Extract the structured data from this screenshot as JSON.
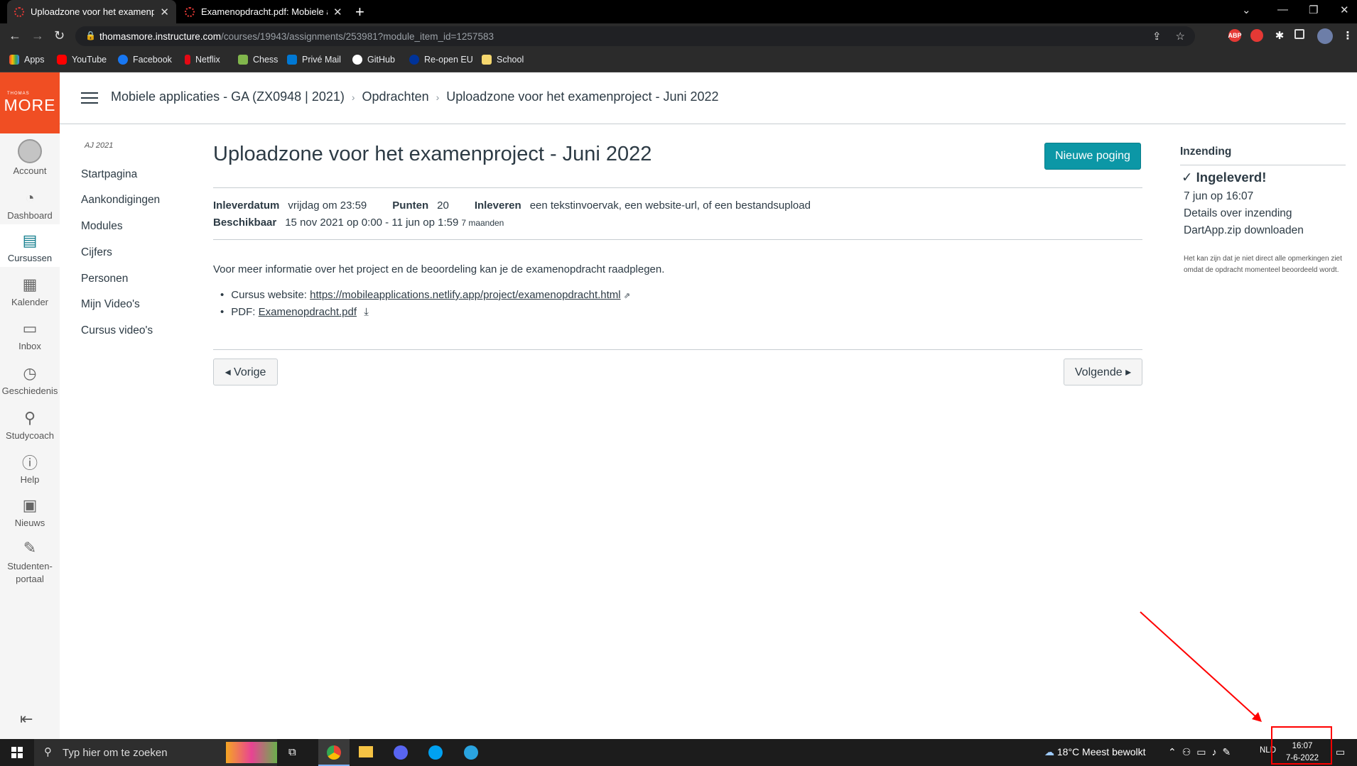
{
  "browser": {
    "tabs": [
      {
        "title": "Uploadzone voor het examenpro",
        "active": true
      },
      {
        "title": "Examenopdracht.pdf: Mobiele ap",
        "active": false
      }
    ],
    "url_host": "thomasmore.instructure.com",
    "url_path": "/courses/19943/assignments/253981?module_item_id=1257583",
    "bookmarks": [
      "Apps",
      "YouTube",
      "Facebook",
      "Netflix",
      "Chess",
      "Privé Mail",
      "GitHub",
      "Re-open EU",
      "School"
    ],
    "ext_abp": "ABP"
  },
  "logo": {
    "small": "THOMAS",
    "big": "MORE"
  },
  "global_nav": [
    "Account",
    "Dashboard",
    "Cursussen",
    "Kalender",
    "Inbox",
    "Geschiedenis",
    "Studycoach",
    "Help",
    "Nieuws",
    "Studenten-portaal"
  ],
  "breadcrumb": [
    "Mobiele applicaties - GA (ZX0948 | 2021)",
    "Opdrachten",
    "Uploadzone voor het examenproject - Juni 2022"
  ],
  "course_nav": {
    "term": "AJ 2021",
    "items": [
      "Startpagina",
      "Aankondigingen",
      "Modules",
      "Cijfers",
      "Personen",
      "Mijn Video's",
      "Cursus video's"
    ]
  },
  "assignment": {
    "title": "Uploadzone voor het examenproject - Juni 2022",
    "new_attempt": "Nieuwe poging",
    "due_label": "Inleverdatum",
    "due_value": "vrijdag om 23:59",
    "points_label": "Punten",
    "points_value": "20",
    "submit_label": "Inleveren",
    "submit_value": "een tekstinvoervak, een website-url, of een bestandsupload",
    "avail_label": "Beschikbaar",
    "avail_value": "15 nov 2021 op 0:00 - 11 jun op 1:59",
    "avail_extra": "7 maanden",
    "description": "Voor meer informatie over het project en de beoordeling kan je de examenopdracht raadplegen.",
    "website_prefix": "Cursus website:",
    "website_link": "https://mobileapplications.netlify.app/project/examenopdracht.html",
    "pdf_prefix": "PDF:",
    "pdf_link": "Examenopdracht.pdf",
    "prev": "◂ Vorige",
    "next": "Volgende ▸"
  },
  "submission": {
    "heading": "Inzending",
    "status": "Ingeleverd!",
    "date": "7 jun op 16:07",
    "details": "Details over inzending",
    "download": "DartApp.zip downloaden",
    "note": "Het kan zijn dat je niet direct alle opmerkingen ziet omdat de opdracht momenteel beoordeeld wordt."
  },
  "taskbar": {
    "search": "Typ hier om te zoeken",
    "weather": "18°C  Meest bewolkt",
    "lang": "NLD",
    "time": "16:07",
    "date": "7-6-2022"
  }
}
